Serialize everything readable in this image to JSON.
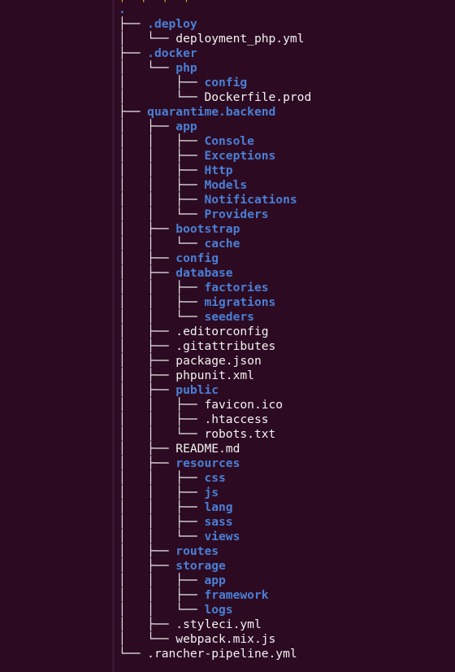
{
  "top_fragment": "│  │  │  │",
  "tree": {
    "root": ".",
    "lines": [
      {
        "prefix": "├── ",
        "name": ".deploy",
        "type": "dir"
      },
      {
        "prefix": "│   └── ",
        "name": "deployment_php.yml",
        "type": "file"
      },
      {
        "prefix": "├── ",
        "name": ".docker",
        "type": "dir"
      },
      {
        "prefix": "│   └── ",
        "name": "php",
        "type": "dir"
      },
      {
        "prefix": "│       ├── ",
        "name": "config",
        "type": "dir"
      },
      {
        "prefix": "│       └── ",
        "name": "Dockerfile.prod",
        "type": "file"
      },
      {
        "prefix": "├── ",
        "name": "quarantime.backend",
        "type": "dir"
      },
      {
        "prefix": "│   ├── ",
        "name": "app",
        "type": "dir"
      },
      {
        "prefix": "│   │   ├── ",
        "name": "Console",
        "type": "dir"
      },
      {
        "prefix": "│   │   ├── ",
        "name": "Exceptions",
        "type": "dir"
      },
      {
        "prefix": "│   │   ├── ",
        "name": "Http",
        "type": "dir"
      },
      {
        "prefix": "│   │   ├── ",
        "name": "Models",
        "type": "dir"
      },
      {
        "prefix": "│   │   ├── ",
        "name": "Notifications",
        "type": "dir"
      },
      {
        "prefix": "│   │   └── ",
        "name": "Providers",
        "type": "dir"
      },
      {
        "prefix": "│   ├── ",
        "name": "bootstrap",
        "type": "dir"
      },
      {
        "prefix": "│   │   └── ",
        "name": "cache",
        "type": "dir"
      },
      {
        "prefix": "│   ├── ",
        "name": "config",
        "type": "dir"
      },
      {
        "prefix": "│   ├── ",
        "name": "database",
        "type": "dir"
      },
      {
        "prefix": "│   │   ├── ",
        "name": "factories",
        "type": "dir"
      },
      {
        "prefix": "│   │   ├── ",
        "name": "migrations",
        "type": "dir"
      },
      {
        "prefix": "│   │   └── ",
        "name": "seeders",
        "type": "dir"
      },
      {
        "prefix": "│   ├── ",
        "name": ".editorconfig",
        "type": "file"
      },
      {
        "prefix": "│   ├── ",
        "name": ".gitattributes",
        "type": "file"
      },
      {
        "prefix": "│   ├── ",
        "name": "package.json",
        "type": "file"
      },
      {
        "prefix": "│   ├── ",
        "name": "phpunit.xml",
        "type": "file"
      },
      {
        "prefix": "│   ├── ",
        "name": "public",
        "type": "dir"
      },
      {
        "prefix": "│   │   ├── ",
        "name": "favicon.ico",
        "type": "file"
      },
      {
        "prefix": "│   │   ├── ",
        "name": ".htaccess",
        "type": "file"
      },
      {
        "prefix": "│   │   └── ",
        "name": "robots.txt",
        "type": "file"
      },
      {
        "prefix": "│   ├── ",
        "name": "README.md",
        "type": "file"
      },
      {
        "prefix": "│   ├── ",
        "name": "resources",
        "type": "dir"
      },
      {
        "prefix": "│   │   ├── ",
        "name": "css",
        "type": "dir"
      },
      {
        "prefix": "│   │   ├── ",
        "name": "js",
        "type": "dir"
      },
      {
        "prefix": "│   │   ├── ",
        "name": "lang",
        "type": "dir"
      },
      {
        "prefix": "│   │   ├── ",
        "name": "sass",
        "type": "dir"
      },
      {
        "prefix": "│   │   └── ",
        "name": "views",
        "type": "dir"
      },
      {
        "prefix": "│   ├── ",
        "name": "routes",
        "type": "dir"
      },
      {
        "prefix": "│   ├── ",
        "name": "storage",
        "type": "dir"
      },
      {
        "prefix": "│   │   ├── ",
        "name": "app",
        "type": "dir"
      },
      {
        "prefix": "│   │   ├── ",
        "name": "framework",
        "type": "dir"
      },
      {
        "prefix": "│   │   └── ",
        "name": "logs",
        "type": "dir"
      },
      {
        "prefix": "│   ├── ",
        "name": ".styleci.yml",
        "type": "file"
      },
      {
        "prefix": "│   └── ",
        "name": "webpack.mix.js",
        "type": "file"
      },
      {
        "prefix": "└── ",
        "name": ".rancher-pipeline.yml",
        "type": "file"
      }
    ]
  },
  "colors": {
    "background": "#2c0b22",
    "directory": "#4a7fd6",
    "file": "#f2f2f2",
    "tree_lines": "#e6e6e6",
    "top_fragment": "#e8b030"
  }
}
